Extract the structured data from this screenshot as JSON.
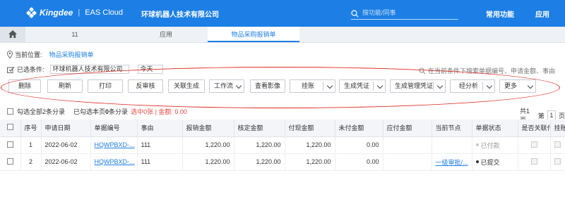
{
  "header": {
    "brand": "Kingdee",
    "product": "EAS Cloud",
    "company": "环球机器人技术有限公司",
    "search_placeholder": "搜功能/同事",
    "common_functions": "常用功能",
    "apps": "应用"
  },
  "tabs": {
    "tab1": "11",
    "tab2": "应用",
    "tab3": "物品采购报销单"
  },
  "location": {
    "label": "当前位置:",
    "value": "物品采购报销单"
  },
  "filter": {
    "label": "已选条件:",
    "company": "环球机器人技术有限公司",
    "date": "今天",
    "search_hint": "在当前条件下搜索单据编号、申请金额、事由"
  },
  "toolbar": {
    "delete": "删除",
    "refresh": "刷新",
    "print": "打印",
    "unaudit": "反审核",
    "linked_gen": "关联生成",
    "workflow": "工作流",
    "view_image": "查看影像",
    "hang_account": "挂账",
    "gen_voucher": "生成凭证",
    "gen_mgmt_voucher": "生成管理凭证",
    "analysis": "经分析",
    "more": "更多"
  },
  "summary": {
    "all_selected": "勾选全部2条分录",
    "page_selected_pre": "已勾选本页",
    "page_selected_count": "0",
    "page_selected_post": "条分录",
    "selected_detail": "选中0张 | 金额: 0.00",
    "total_pages": "共1页",
    "page_label": "第",
    "page_num": "1",
    "page_suffix": "页"
  },
  "table": {
    "headers": {
      "seq": "序号",
      "apply_date": "申请日期",
      "doc_no": "单据编号",
      "reason": "事由",
      "claim_amount": "报销金额",
      "approved_amount": "核定金额",
      "paid_amount": "付现金额",
      "unpaid_amount": "未付金额",
      "payable_amount": "应付金额",
      "current_node": "当前节点",
      "doc_status": "单据状态",
      "is_linked": "是否关联付",
      "hang": "挂账"
    },
    "rows": [
      {
        "seq": "1",
        "apply_date": "2022-06-02",
        "doc_no": "HQWPBXD-...",
        "reason": "111",
        "claim_amount": "1,220.00",
        "approved_amount": "1,220.00",
        "paid_amount": "1,220.00",
        "unpaid_amount": "0.00",
        "payable_amount": "",
        "current_node": "",
        "doc_status": "已付款"
      },
      {
        "seq": "2",
        "apply_date": "2022-06-02",
        "doc_no": "HQWPBXD-...",
        "reason": "111",
        "claim_amount": "1,220.00",
        "approved_amount": "1,220.00",
        "paid_amount": "1,220.00",
        "unpaid_amount": "0.00",
        "payable_amount": "",
        "current_node": "一级审批/...",
        "doc_status": "已提交"
      }
    ]
  },
  "colors": {
    "primary": "#1d7fe5",
    "annotation_red": "#e02b1f",
    "paid_dot": "#c8c8c8",
    "submitted_dot": "#333333"
  }
}
